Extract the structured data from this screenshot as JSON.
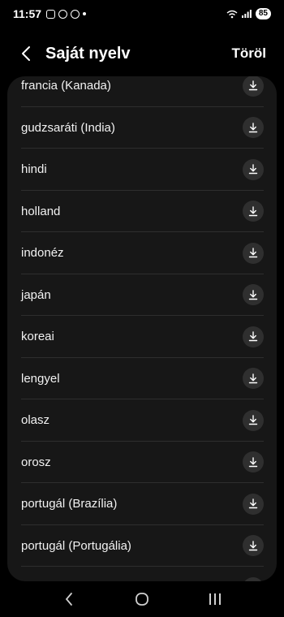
{
  "status": {
    "time": "11:57",
    "battery": "85"
  },
  "header": {
    "title": "Saját nyelv",
    "action": "Töröl"
  },
  "languages": [
    "francia (Kanada)",
    "gudzsaráti (India)",
    "hindi",
    "holland",
    "indonéz",
    "japán",
    "koreai",
    "lengyel",
    "olasz",
    "orosz",
    "portugál (Brazília)",
    "portugál (Portugália)",
    ""
  ],
  "icons": {
    "back": "chevron-left-icon",
    "download": "download-icon",
    "nav_back": "nav-back-icon",
    "nav_home": "nav-home-icon",
    "nav_recents": "nav-recents-icon"
  }
}
